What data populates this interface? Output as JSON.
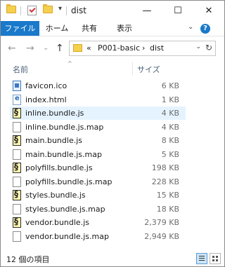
{
  "window": {
    "title": "dist",
    "minimize_glyph": "—",
    "maximize_glyph": "☐",
    "close_glyph": "✕"
  },
  "ribbon": {
    "tabs": [
      "ファイル",
      "ホーム",
      "共有",
      "表示"
    ],
    "expand_glyph": "⌄",
    "help_glyph": "?"
  },
  "nav": {
    "back_glyph": "←",
    "forward_glyph": "→",
    "recent_glyph": "⌄",
    "up_glyph": "↑"
  },
  "address": {
    "overflow": "«",
    "crumbs": [
      "P001-basic",
      "dist"
    ],
    "separator": "›",
    "dropdown_glyph": "⌄",
    "refresh_glyph": "↻"
  },
  "columns": {
    "name": "名前",
    "size": "サイズ",
    "sort_glyph": "^"
  },
  "files": [
    {
      "name": "favicon.ico",
      "size": "6 KB",
      "icon": "ico-file-icon",
      "type": "ico"
    },
    {
      "name": "index.html",
      "size": "1 KB",
      "icon": "html-file-icon",
      "type": "html"
    },
    {
      "name": "inline.bundle.js",
      "size": "4 KB",
      "icon": "js-file-icon",
      "type": "js",
      "selected": true
    },
    {
      "name": "inline.bundle.js.map",
      "size": "4 KB",
      "icon": "map-file-icon",
      "type": "map"
    },
    {
      "name": "main.bundle.js",
      "size": "8 KB",
      "icon": "js-file-icon",
      "type": "js"
    },
    {
      "name": "main.bundle.js.map",
      "size": "5 KB",
      "icon": "map-file-icon",
      "type": "map"
    },
    {
      "name": "polyfills.bundle.js",
      "size": "198 KB",
      "icon": "js-file-icon",
      "type": "js"
    },
    {
      "name": "polyfills.bundle.js.map",
      "size": "228 KB",
      "icon": "map-file-icon",
      "type": "map"
    },
    {
      "name": "styles.bundle.js",
      "size": "15 KB",
      "icon": "js-file-icon",
      "type": "js"
    },
    {
      "name": "styles.bundle.js.map",
      "size": "18 KB",
      "icon": "map-file-icon",
      "type": "map"
    },
    {
      "name": "vendor.bundle.js",
      "size": "2,379 KB",
      "icon": "js-file-icon",
      "type": "js"
    },
    {
      "name": "vendor.bundle.js.map",
      "size": "2,949 KB",
      "icon": "map-file-icon",
      "type": "map"
    }
  ],
  "status": {
    "item_count": "12 個の項目"
  },
  "colors": {
    "accent": "#1979ca",
    "selection": "#e5f3ff",
    "header_text": "#4c607a"
  }
}
